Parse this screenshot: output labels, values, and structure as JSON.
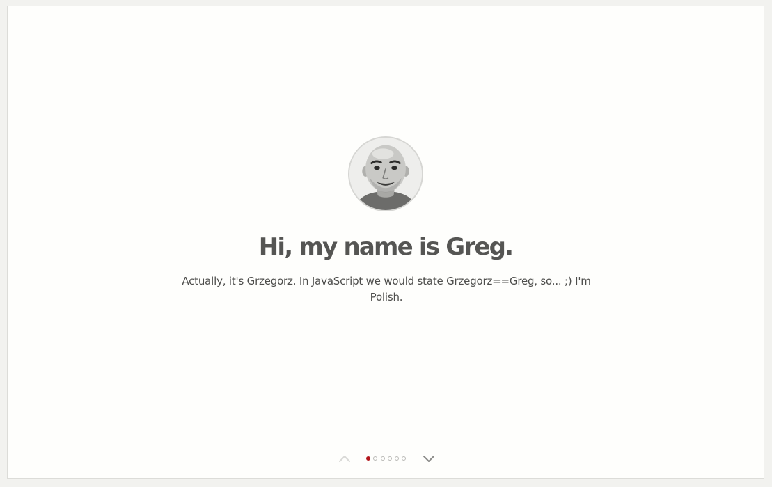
{
  "slide": {
    "avatar_alt": "Greg portrait",
    "title": "Hi, my name is Greg.",
    "description": "Actually, it's Grzegorz. In JavaScript we would state Grzegorz==Greg, so... ;) I'm Polish."
  },
  "navigation": {
    "prev_icon": "chevron-up-icon",
    "next_icon": "chevron-down-icon",
    "total_slides": 6,
    "current_slide": 1,
    "active_color": "#b3161c"
  }
}
